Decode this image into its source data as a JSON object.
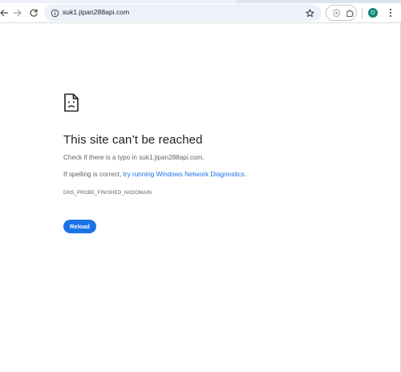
{
  "toolbar": {
    "back_icon": "arrow-left-icon",
    "forward_icon": "arrow-right-icon",
    "reload_icon": "reload-icon",
    "url": "suk1.jipan288api.com",
    "site_info_icon": "tune-icon",
    "bookmark_icon": "star-outline-icon",
    "extension1_icon": "shield-extension-icon",
    "extension2_icon": "puzzle-icon",
    "profile_initial": "O",
    "menu_icon": "vertical-dots-icon"
  },
  "error_page": {
    "icon": "sad-document-icon",
    "title": "This site can’t be reached",
    "typo_prefix": "Check if there is a typo in ",
    "typo_host": "suk1.jipan288api.com",
    "typo_suffix": ".",
    "spelling_prefix": "If spelling is correct, ",
    "diagnostics_link": "try running Windows Network Diagnostics",
    "spelling_suffix": ".",
    "error_code": "DNS_PROBE_FINISHED_NXDOMAIN",
    "reload_label": "Reload"
  },
  "colors": {
    "accent": "#1a73e8",
    "avatar": "#12857a",
    "omnibox_bg": "#edf2fa"
  }
}
